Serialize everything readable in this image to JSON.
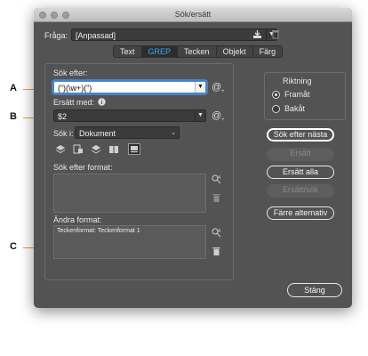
{
  "window": {
    "title": "Sök/ersätt"
  },
  "query": {
    "label": "Fråga:",
    "value": "[Anpassad]"
  },
  "tabs": [
    {
      "label": "Text",
      "active": false
    },
    {
      "label": "GREP",
      "active": true
    },
    {
      "label": "Tecken",
      "active": false
    },
    {
      "label": "Objekt",
      "active": false
    },
    {
      "label": "Färg",
      "active": false
    }
  ],
  "find": {
    "label": "Sök efter:",
    "value": "(“)(\\w+)(”)"
  },
  "change": {
    "label": "Ersätt med:",
    "value": "$2"
  },
  "search_in": {
    "label": "Sök i:",
    "value": "Dokument"
  },
  "find_format": {
    "label": "Sök efter format:"
  },
  "change_format": {
    "label": "Ändra format:",
    "value": "Teckenformat: Teckenformat 1"
  },
  "direction": {
    "label": "Riktning",
    "forward": "Framåt",
    "backward": "Bakåt",
    "selected": "forward"
  },
  "buttons": {
    "find_next": "Sök efter nästa",
    "change": "Ersätt",
    "change_all": "Ersätt alla",
    "change_find": "Ersätt/sök",
    "fewer_options": "Färre alternativ",
    "done": "Stäng"
  },
  "callouts": {
    "a": "A",
    "b": "B",
    "c": "C"
  },
  "colors": {
    "dialog_bg": "#535353",
    "active_tab": "#3fa9f5",
    "focus_ring": "#3d8bdc",
    "leader_line": "#e2a21b"
  }
}
